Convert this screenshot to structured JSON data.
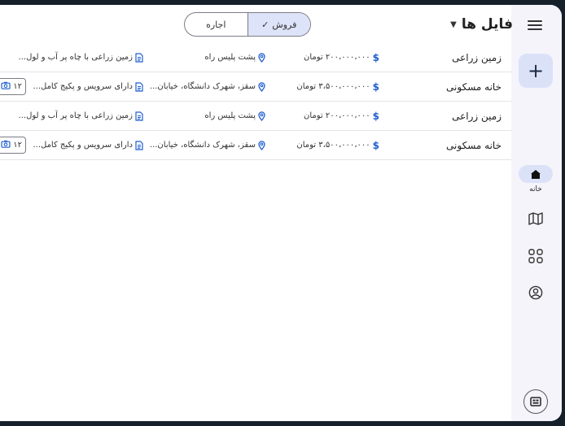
{
  "header": {
    "title": "فایل ها",
    "segments": [
      {
        "label": "فروش",
        "active": true
      },
      {
        "label": "اجاره",
        "active": false
      }
    ]
  },
  "rows": [
    {
      "type": "زمین زراعی",
      "price": "۲۰۰،۰۰۰،۰۰۰ تومان",
      "location": "پشت پلیس راه",
      "description": "زمین زراعی با چاه پر آب و لول...",
      "photos": null
    },
    {
      "type": "خانه مسکونی",
      "price": "۳،۵۰۰،۰۰۰،۰۰۰ تومان",
      "location": "سقز، شهرک دانشگاه، خیابان...",
      "description": "دارای سرویس و پکیج کامل...",
      "photos": "۱۲"
    },
    {
      "type": "زمین زراعی",
      "price": "۲۰۰،۰۰۰،۰۰۰ تومان",
      "location": "پشت پلیس راه",
      "description": "زمین زراعی با چاه پر آب و لول...",
      "photos": null
    },
    {
      "type": "خانه مسکونی",
      "price": "۳،۵۰۰،۰۰۰،۰۰۰ تومان",
      "location": "سقز، شهرک دانشگاه، خیابان...",
      "description": "دارای سرویس و پکیج کامل...",
      "photos": "۱۲"
    }
  ],
  "rail": {
    "fab_icon": "plus-icon",
    "home_label": "خانه",
    "items": [
      "home-icon",
      "map-icon",
      "apps-grid-icon",
      "account-icon"
    ],
    "bottom_icon": "keyboard-icon"
  },
  "colors": {
    "accent": "#1f5fcf",
    "active_bg": "#dbe2f8",
    "rail_bg": "#f6f4fb"
  }
}
